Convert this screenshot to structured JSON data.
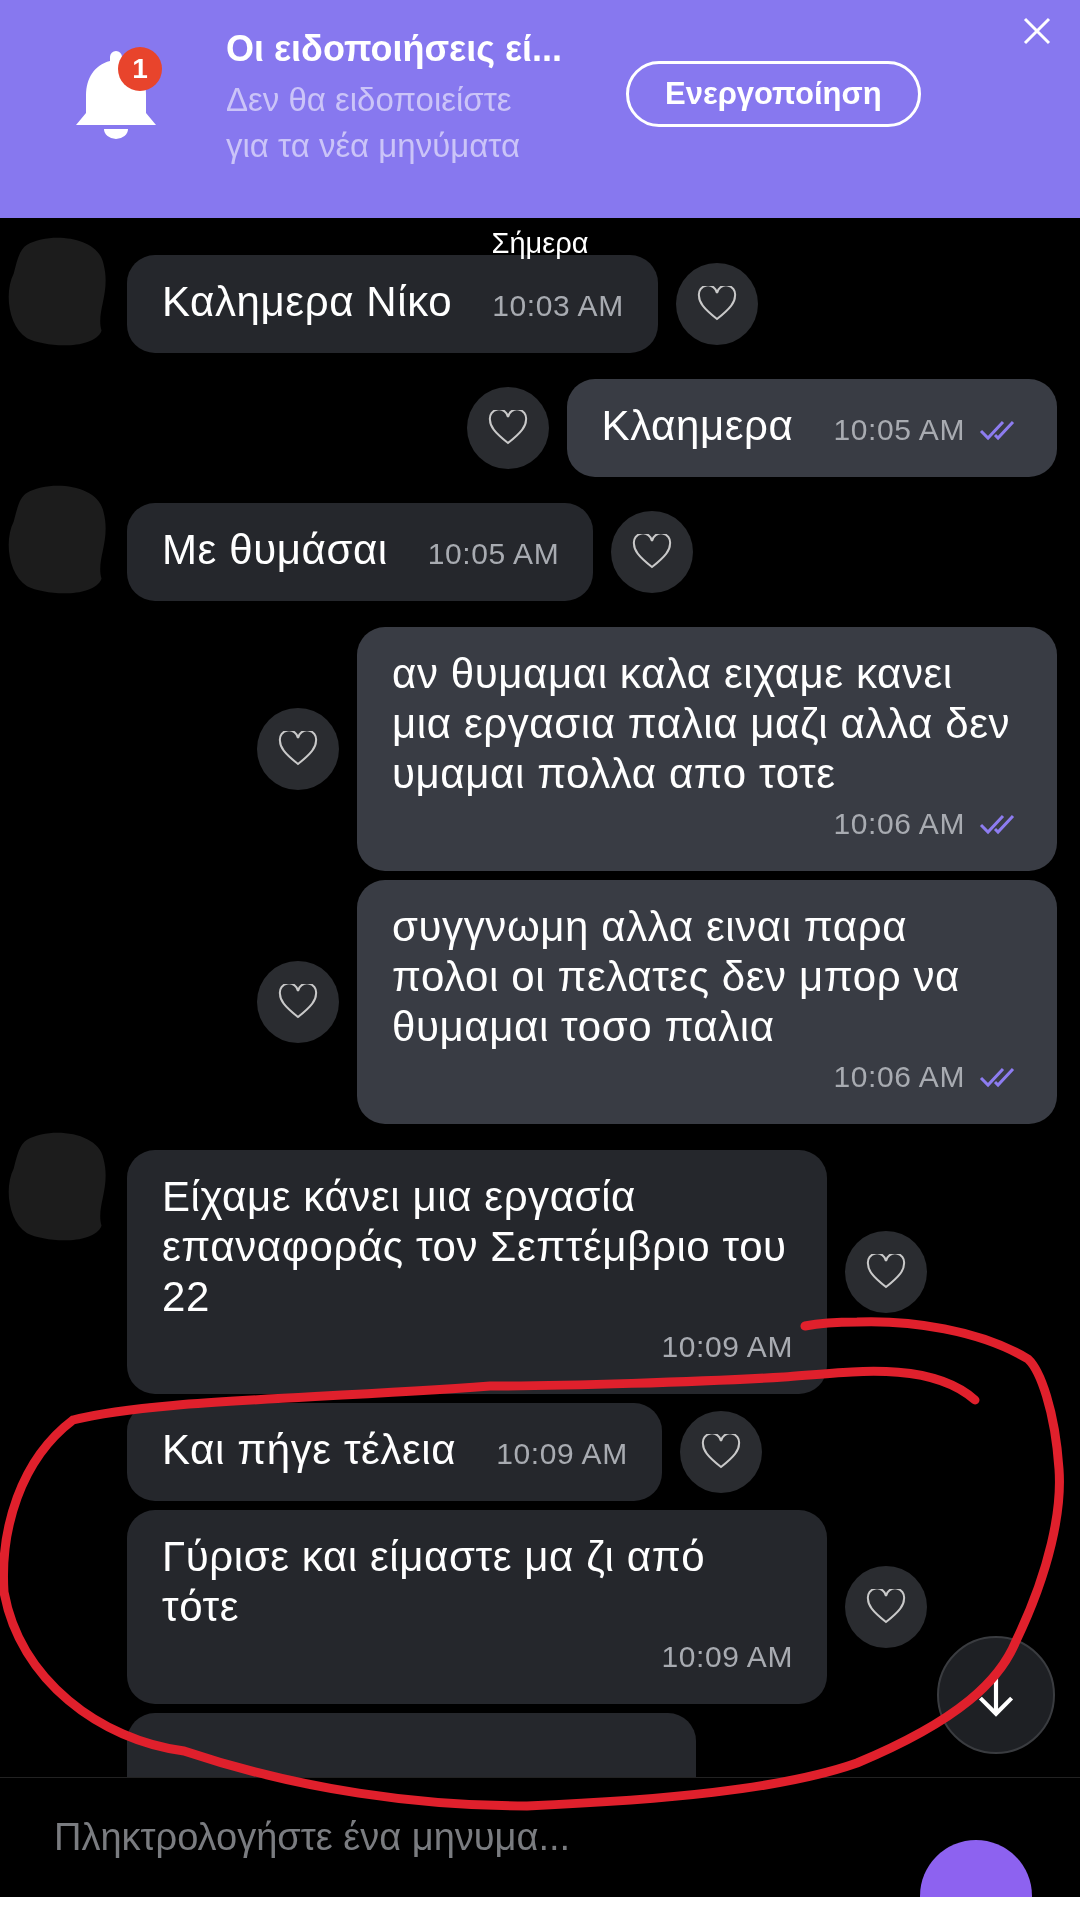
{
  "banner": {
    "badge": "1",
    "title": "Οι ειδοποιήσεις εί...",
    "subtitle": "Δεν θα ειδοποιείστε για τα νέα μηνύματα",
    "button": "Ενεργοποίηση"
  },
  "date_label": "Σήμερα",
  "messages": [
    {
      "kind": "incoming",
      "avatar": true,
      "text": "Καλημερα Νίκο",
      "time": "10:03 AM"
    },
    {
      "kind": "outgoing",
      "read": true,
      "text": "Κλαημερα",
      "time": "10:05 AM"
    },
    {
      "kind": "incoming",
      "avatar": true,
      "text": "Με θυμάσαι",
      "time": "10:05 AM"
    },
    {
      "kind": "outgoing",
      "read": true,
      "text": "αν θυμαμαι καλα ειχαμε κανει μια εργασια παλια μαζι αλλα δεν υμαμαι πολλα απο τοτε",
      "time": "10:06 AM"
    },
    {
      "kind": "outgoing",
      "read": true,
      "text": "συγγνωμη αλλα ειναι παρα πολοι οι πελατες δεν μπορ να θυμαμαι τοσο παλια",
      "time": "10:06 AM"
    },
    {
      "kind": "incoming",
      "avatar": true,
      "text": "Είχαμε κάνει μια εργασία επαναφοράς τον Σεπτέμβριο του 22",
      "time": "10:09 AM"
    },
    {
      "kind": "incoming",
      "avatar": false,
      "text": "Και πήγε τέλεια",
      "time": "10:09 AM"
    },
    {
      "kind": "incoming",
      "avatar": false,
      "text": "Γύρισε και είμαστε μα ζι από τότε",
      "time": "10:09 AM"
    },
    {
      "kind": "incoming",
      "avatar": false
    }
  ],
  "composer": {
    "placeholder": "Πληκτρολογήστε ένα μηνυμα..."
  },
  "annotation": {
    "kind": "freehand-circle",
    "color": "#e0202c"
  }
}
